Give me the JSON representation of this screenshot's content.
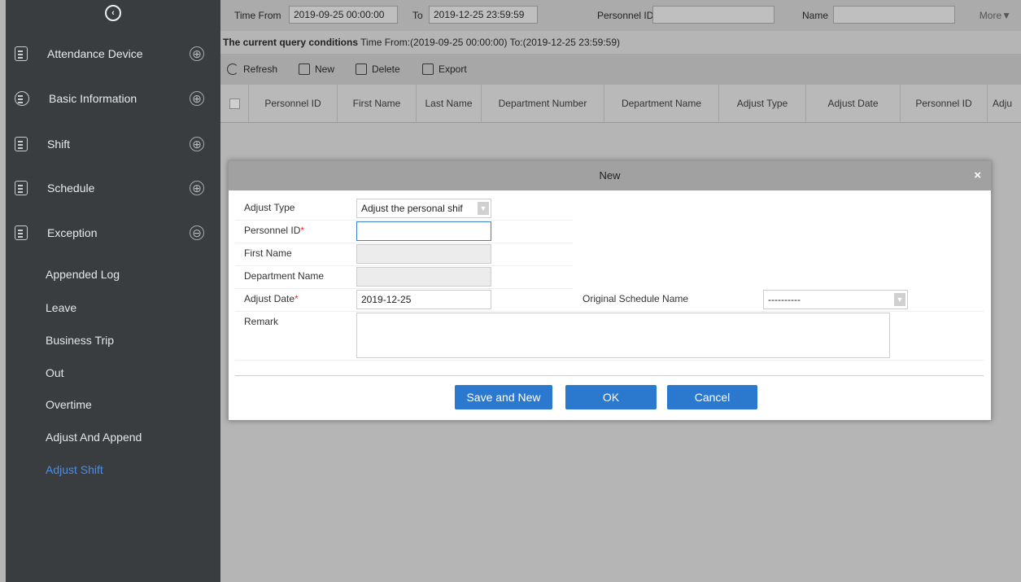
{
  "sidebar": {
    "menu": [
      {
        "label": "Attendance Device",
        "icon": "device-icon",
        "expanded": false
      },
      {
        "label": "Basic Information",
        "icon": "info-icon",
        "expanded": false
      },
      {
        "label": "Shift",
        "icon": "shift-icon",
        "expanded": false
      },
      {
        "label": "Schedule",
        "icon": "schedule-icon",
        "expanded": false
      },
      {
        "label": "Exception",
        "icon": "exception-icon",
        "expanded": true
      }
    ],
    "expand_symbol": "⊕",
    "collapse_symbol": "⊖",
    "submenu": [
      {
        "label": "Appended Log"
      },
      {
        "label": "Leave"
      },
      {
        "label": "Business Trip"
      },
      {
        "label": "Out"
      },
      {
        "label": "Overtime"
      },
      {
        "label": "Adjust And Append"
      },
      {
        "label": "Adjust Shift",
        "active": true
      }
    ]
  },
  "query": {
    "time_from_label": "Time From",
    "time_from_value": "2019-09-25 00:00:00",
    "to_label": "To",
    "to_value": "2019-12-25 23:59:59",
    "personnel_id_label": "Personnel ID",
    "personnel_id_value": "",
    "name_label": "Name",
    "name_value": "",
    "more_label": "More▼"
  },
  "conditions": {
    "prefix": "The current query conditions",
    "text": " Time From:(2019-09-25 00:00:00)  To:(2019-12-25 23:59:59)"
  },
  "toolbar": {
    "refresh": "Refresh",
    "new": "New",
    "delete": "Delete",
    "export": "Export"
  },
  "table": {
    "columns": [
      "Personnel ID",
      "First Name",
      "Last Name",
      "Department Number",
      "Department Name",
      "Adjust Type",
      "Adjust Date",
      "Personnel ID",
      "Adju"
    ]
  },
  "dialog": {
    "title": "New",
    "close": "×",
    "adjust_type_label": "Adjust Type",
    "adjust_type_value": "Adjust the personal shif",
    "personnel_id_label": "Personnel ID",
    "personnel_id_value": "",
    "first_name_label": "First Name",
    "first_name_value": "",
    "department_name_label": "Department Name",
    "department_name_value": "",
    "adjust_date_label": "Adjust Date",
    "adjust_date_value": "2019-12-25",
    "original_schedule_label": "Original Schedule Name",
    "original_schedule_value": "----------",
    "remark_label": "Remark",
    "remark_value": "",
    "required_mark": "*",
    "save_new_label": "Save and New",
    "ok_label": "OK",
    "cancel_label": "Cancel"
  }
}
